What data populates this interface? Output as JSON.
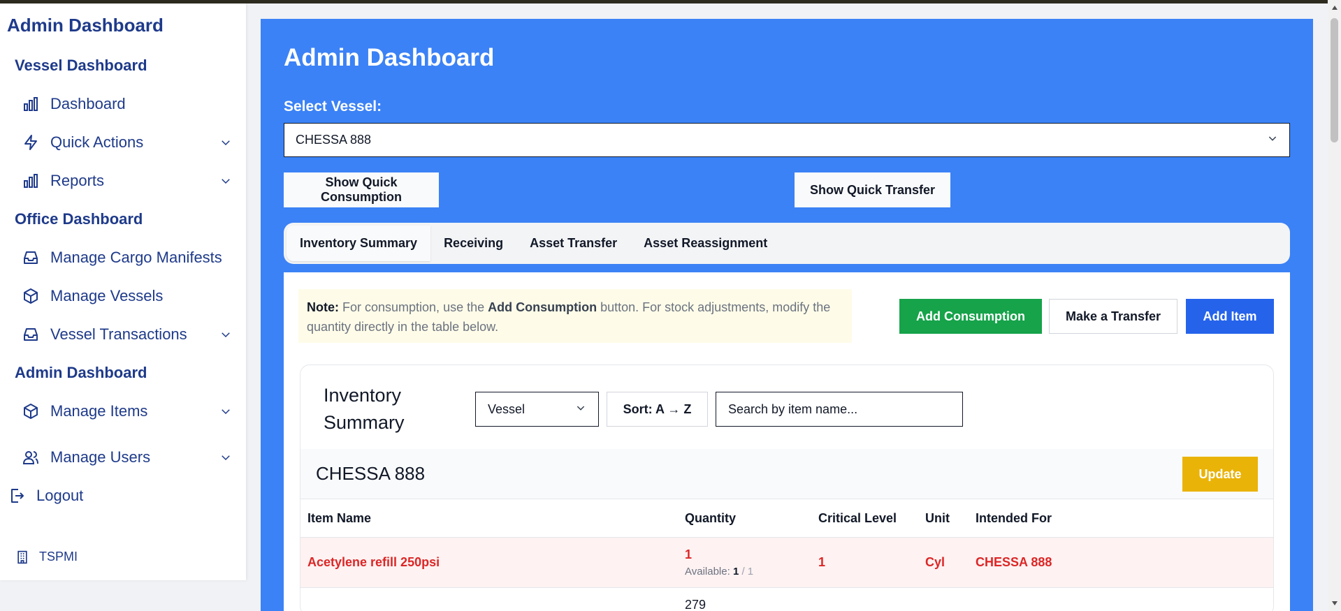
{
  "sidebar": {
    "brand": "Admin Dashboard",
    "sections": {
      "vessel": "Vessel Dashboard",
      "office": "Office Dashboard",
      "admin": "Admin Dashboard"
    },
    "items": {
      "dashboard": "Dashboard",
      "quick_actions": "Quick Actions",
      "reports": "Reports",
      "cargo": "Manage Cargo Manifests",
      "vessels": "Manage Vessels",
      "transactions": "Vessel Transactions",
      "items": "Manage Items",
      "users": "Manage Users",
      "logout": "Logout"
    },
    "footer": "TSPMI"
  },
  "main": {
    "title": "Admin Dashboard",
    "select_label": "Select Vessel:",
    "selected_vessel": "CHESSA 888",
    "quick_consumption": "Show Quick Consumption",
    "quick_transfer": "Show Quick Transfer",
    "tabs": [
      "Inventory Summary",
      "Receiving",
      "Asset Transfer",
      "Asset Reassignment"
    ],
    "note": {
      "prefix": "Note:",
      "t1": " For consumption, use the ",
      "bold": "Add Consumption",
      "t2": " button. For stock adjustments, modify the quantity directly in the table below."
    },
    "buttons": {
      "add_consumption": "Add Consumption",
      "make_transfer": "Make a Transfer",
      "add_item": "Add Item"
    }
  },
  "inventory": {
    "title": "Inventory Summary",
    "filter": "Vessel",
    "sort": "Sort: A → Z",
    "search_placeholder": "Search by item name...",
    "vessel_name": "CHESSA 888",
    "update": "Update",
    "columns": [
      "Item Name",
      "Quantity",
      "Critical Level",
      "Unit",
      "Intended For"
    ],
    "rows": [
      {
        "item": "Acetylene refill 250psi",
        "quantity": "1",
        "available_label": "Available:",
        "available": "1",
        "available_total": "/ 1",
        "critical": "1",
        "unit": "Cyl",
        "intended": "CHESSA 888"
      },
      {
        "quantity": "279"
      }
    ]
  },
  "colors": {
    "primary": "#3b82f6",
    "navy": "#1e3a8a",
    "green": "#16a34a",
    "blue": "#2563eb",
    "yellow": "#eab308",
    "alert": "#dc2626"
  }
}
